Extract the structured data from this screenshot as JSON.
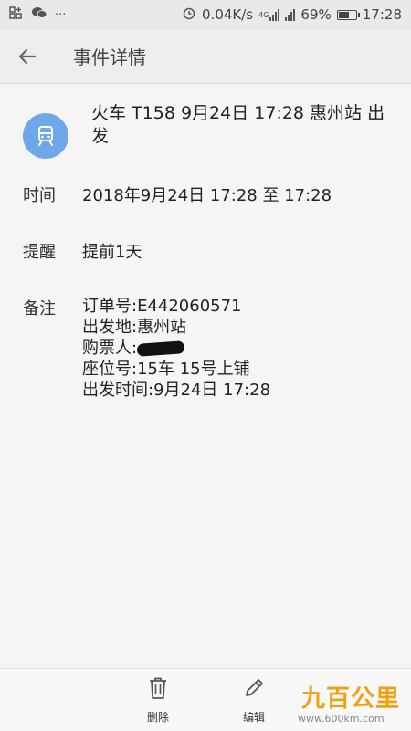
{
  "status_bar": {
    "left_icons": [
      "app-grid-icon",
      "wechat-icon",
      "more-dots-icon"
    ],
    "network_speed": "0.04K/s",
    "network_type": "4G",
    "battery": "69%",
    "battery_level": 0.69,
    "time": "17:28"
  },
  "titlebar": {
    "back_icon": "back-arrow-icon",
    "title": "事件详情"
  },
  "event": {
    "icon": "train-icon",
    "title": "火车 T158 9月24日 17:28 惠州站 出发",
    "accent_color": "#6fa8e8"
  },
  "details": {
    "time_label": "时间",
    "time_value": "2018年9月24日 17:28  至 17:28",
    "reminder_label": "提醒",
    "reminder_value": "提前1天",
    "notes_label": "备注",
    "notes": {
      "order": "订单号:E442060571",
      "departure": "出发地:惠州站",
      "buyer": "购票人:",
      "seat": "座位号:15车 15号上铺",
      "depart_time": "出发时间:9月24日 17:28"
    }
  },
  "bottom_bar": {
    "delete_label": "删除",
    "delete_icon": "trash-icon",
    "edit_label": "编辑",
    "edit_icon": "pencil-icon"
  },
  "watermark": {
    "brand": "九百公里",
    "url": "www.600km.com"
  }
}
